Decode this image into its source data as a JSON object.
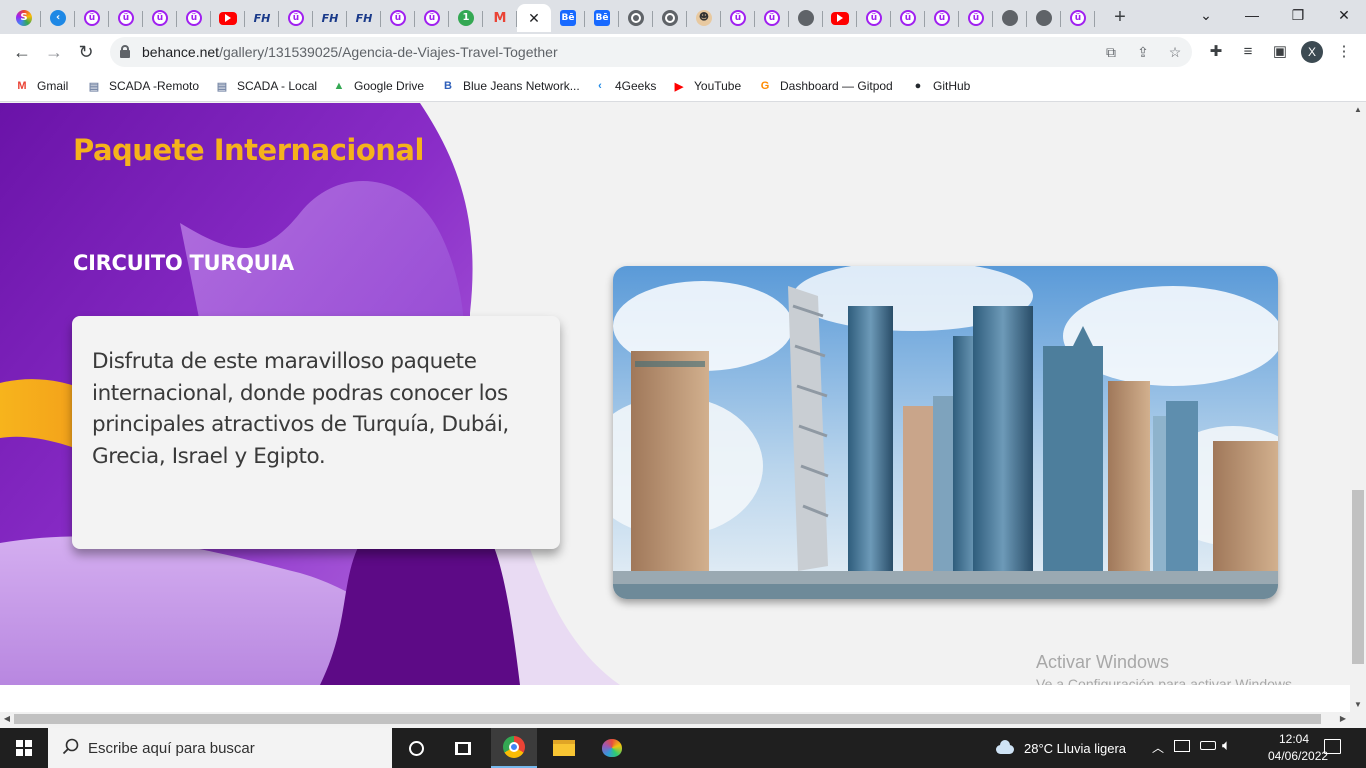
{
  "browser": {
    "tabs": [
      {
        "icon": "rainbow-app-icon",
        "glyph": "S",
        "kind": "rainbow"
      },
      {
        "icon": "4geeks-icon",
        "glyph": "‹",
        "kind": "blue4"
      },
      {
        "icon": "u-app-icon",
        "glyph": "ü",
        "kind": "u"
      },
      {
        "icon": "u-app-icon",
        "glyph": "ü",
        "kind": "u"
      },
      {
        "icon": "u-app-icon",
        "glyph": "ü",
        "kind": "u"
      },
      {
        "icon": "u-app-icon",
        "glyph": "ü",
        "kind": "u"
      },
      {
        "icon": "youtube-icon",
        "glyph": "",
        "kind": "yt"
      },
      {
        "icon": "fh-icon",
        "glyph": "FH",
        "kind": "fh"
      },
      {
        "icon": "u-app-icon",
        "glyph": "ü",
        "kind": "u"
      },
      {
        "icon": "fh-icon",
        "glyph": "FH",
        "kind": "fh"
      },
      {
        "icon": "fh-icon",
        "glyph": "FH",
        "kind": "fh"
      },
      {
        "icon": "u-app-icon",
        "glyph": "ü",
        "kind": "u"
      },
      {
        "icon": "u-app-icon",
        "glyph": "ü",
        "kind": "u"
      },
      {
        "icon": "green-badge-icon",
        "glyph": "1",
        "kind": "green"
      },
      {
        "icon": "gmail-icon",
        "glyph": "M",
        "kind": "gmail"
      },
      {
        "icon": "close-icon",
        "glyph": "✕",
        "kind": "active"
      },
      {
        "icon": "behance-icon",
        "glyph": "Bē",
        "kind": "be"
      },
      {
        "icon": "behance-icon",
        "glyph": "Bē",
        "kind": "be"
      },
      {
        "icon": "chrome-icon",
        "glyph": "",
        "kind": "chrome"
      },
      {
        "icon": "chrome-icon",
        "glyph": "",
        "kind": "chrome"
      },
      {
        "icon": "avatar-face-icon",
        "glyph": "☻",
        "kind": "face"
      },
      {
        "icon": "u-app-icon",
        "glyph": "ü",
        "kind": "u"
      },
      {
        "icon": "u-app-icon",
        "glyph": "ü",
        "kind": "u"
      },
      {
        "icon": "globe-icon",
        "glyph": "",
        "kind": "globe"
      },
      {
        "icon": "youtube-icon",
        "glyph": "",
        "kind": "yt"
      },
      {
        "icon": "u-app-icon",
        "glyph": "ü",
        "kind": "u"
      },
      {
        "icon": "u-app-icon",
        "glyph": "ü",
        "kind": "u"
      },
      {
        "icon": "u-app-icon",
        "glyph": "ü",
        "kind": "u"
      },
      {
        "icon": "u-app-icon",
        "glyph": "ü",
        "kind": "u"
      },
      {
        "icon": "globe-icon",
        "glyph": "",
        "kind": "globe"
      },
      {
        "icon": "globe-icon",
        "glyph": "",
        "kind": "globe"
      },
      {
        "icon": "u-app-icon",
        "glyph": "ü",
        "kind": "u"
      }
    ],
    "new_tab_label": "+",
    "url_domain": "behance.net",
    "url_path": "/gallery/131539025/Agencia-de-Viajes-Travel-Together",
    "profile_initial": "X",
    "bookmarks": [
      {
        "label": "Gmail",
        "icon": "gmail-icon",
        "glyph": "M",
        "color": "#ea4335"
      },
      {
        "label": "SCADA -Remoto",
        "icon": "page-icon",
        "glyph": "▤",
        "color": "#7a8aa8"
      },
      {
        "label": "SCADA - Local",
        "icon": "page-icon",
        "glyph": "▤",
        "color": "#7a8aa8"
      },
      {
        "label": "Google Drive",
        "icon": "google-drive-icon",
        "glyph": "▲",
        "color": "#34a853"
      },
      {
        "label": "Blue Jeans Network...",
        "icon": "bluejeans-icon",
        "glyph": "B",
        "color": "#2e5fba"
      },
      {
        "label": "4Geeks",
        "icon": "4geeks-icon",
        "glyph": "‹",
        "color": "#1e88e5"
      },
      {
        "label": "YouTube",
        "icon": "youtube-icon",
        "glyph": "▶",
        "color": "#ff0000"
      },
      {
        "label": "Dashboard — Gitpod",
        "icon": "gitpod-icon",
        "glyph": "G",
        "color": "#ff8a00"
      },
      {
        "label": "GitHub",
        "icon": "github-icon",
        "glyph": "●",
        "color": "#24292e"
      }
    ]
  },
  "page": {
    "section_title": "Paquete Internacional",
    "subtitle": "CIRCUITO TURQUIA",
    "description": "Disfruta de este maravilloso paquete internacional, donde podras conocer los principales atractivos de Turquía, Dubái, Grecia, Israel y Egipto.",
    "watermark_line1": "Activar Windows",
    "watermark_line2": "Ve a Configuración para activar Windows."
  },
  "taskbar": {
    "search_placeholder": "Escribe aquí para buscar",
    "weather": "28°C  Lluvia ligera",
    "time": "12:04",
    "date": "04/06/2022"
  },
  "colors": {
    "accent_yellow": "#f5b21c",
    "purple_dark": "#5a0a8a",
    "purple_mid": "#9b3dd6",
    "purple_light": "#c99be6"
  }
}
